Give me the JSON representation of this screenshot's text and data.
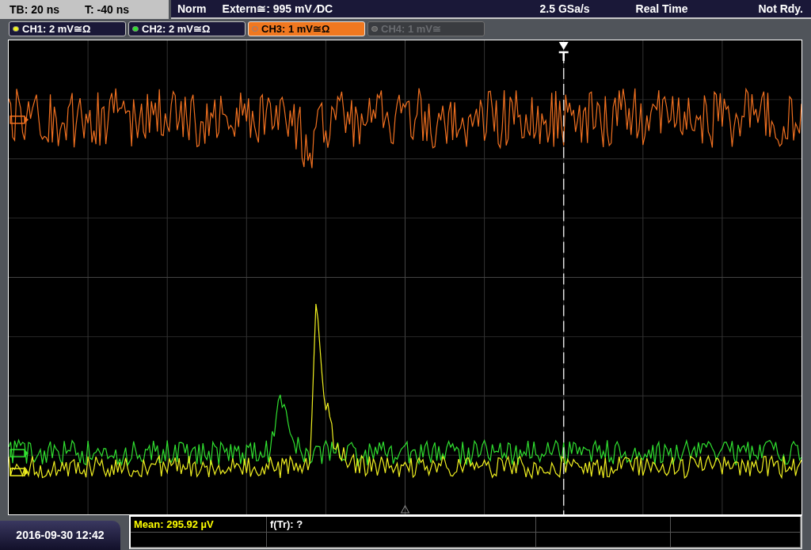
{
  "timebase": {
    "tb": "TB: 20 ns",
    "t": "T: -40 ns"
  },
  "trigger": {
    "mode": "Norm",
    "source": "Extern≅: 995 mV ⁄DC",
    "rate": "2.5 GSa/s",
    "acquisition": "Real Time",
    "status": "Not Rdy."
  },
  "channels": [
    {
      "label": "CH1: 2 mV≅Ω",
      "color": "#f0f020",
      "selected": false,
      "enabled": true
    },
    {
      "label": "CH2: 2 mV≅Ω",
      "color": "#30e030",
      "selected": false,
      "enabled": true
    },
    {
      "label": "CH3: 1 mV≅Ω",
      "color": "#f07020",
      "selected": true,
      "enabled": true
    },
    {
      "label": "CH4: 1 mV≅",
      "color": "#606060",
      "selected": false,
      "enabled": false
    }
  ],
  "date": "2016-09-30 12:42",
  "measurements": [
    {
      "text": "Mean: 295.92 µV",
      "color": "#ffff00"
    },
    {
      "text": "f(Tr): ?",
      "color": "#ffffff"
    }
  ]
}
